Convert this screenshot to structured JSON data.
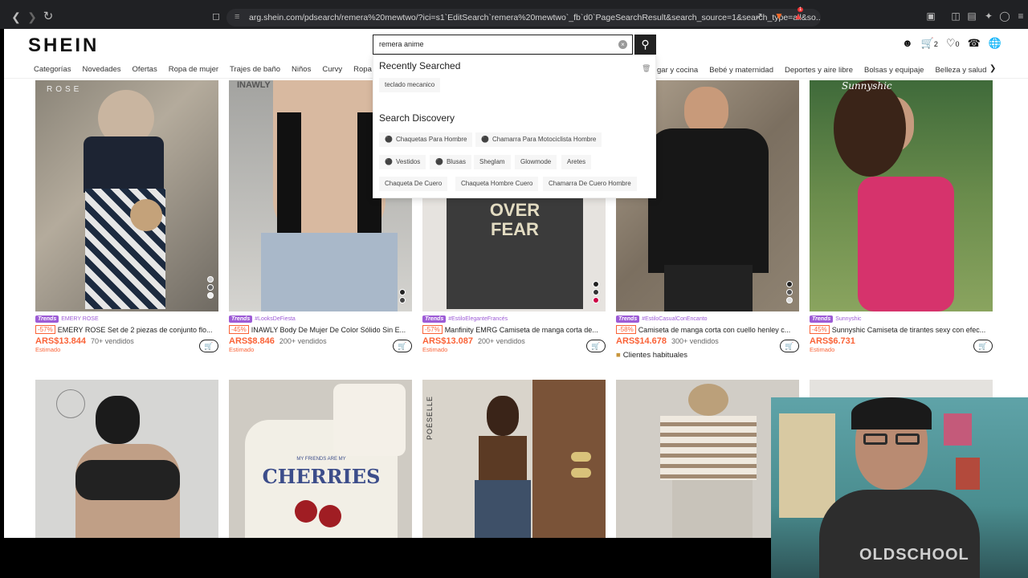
{
  "browser": {
    "url": "arg.shein.com/pdsearch/remera%20mewtwo/?ici=s1`EditSearch`remera%20mewtwo`_fb`d0`PageSearchResult&search_source=1&search_type=all&so...",
    "back_icon": "back-arrow-icon",
    "forward_icon": "forward-arrow-icon",
    "reload_icon": "reload-icon",
    "extension_badge": "1"
  },
  "header": {
    "logo": "SHEIN",
    "search_value": "remera anime",
    "cart_count": "2",
    "wishlist_count": "0"
  },
  "categories_left": [
    "Categorías",
    "Novedades",
    "Ofertas",
    "Ropa de mujer",
    "Trajes de baño",
    "Niños",
    "Curvy",
    "Ropa pa"
  ],
  "categories_right": [
    "gar y cocina",
    "Bebé y maternidad",
    "Deportes y aire libre",
    "Bolsas y equipaje",
    "Belleza y salud"
  ],
  "dropdown": {
    "recent_heading": "Recently Searched",
    "recent_items": [
      "teclado mecanico"
    ],
    "discovery_heading": "Search Discovery",
    "discovery_row1": [
      "Chaquetas Para Hombre",
      "Chamarra Para Motociclista Hombre"
    ],
    "discovery_row2": [
      "Vestidos",
      "Blusas",
      "Sheglam",
      "Glowmode",
      "Aretes"
    ],
    "discovery_row3": [
      "Chaqueta De Cuero",
      "Chaqueta Hombre Cuero",
      "Chamarra De Cuero Hombre"
    ]
  },
  "products": [
    {
      "trend_label": "Trends",
      "store": "EMERY ROSE",
      "discount": "-57%",
      "title": "EMERY ROSE Set de 2 piezas de conjunto flo...",
      "price": "ARS$13.844",
      "sold": "70+ vendidos",
      "est": "Estimado"
    },
    {
      "trend_label": "Trends",
      "store": "#LooksDeFiesta",
      "discount": "-45%",
      "title": "INAWLY Body De Mujer De Color Sólido Sin E...",
      "price": "ARS$8.846",
      "sold": "200+ vendidos",
      "est": "Estimado"
    },
    {
      "trend_label": "Trends",
      "store": "#EstiloEleganteFrancés",
      "discount": "-57%",
      "title": "Manfinity EMRG Camiseta de manga corta de...",
      "price": "ARS$13.087",
      "sold": "200+ vendidos",
      "est": "Estimado"
    },
    {
      "trend_label": "Trends",
      "store": "#EstiloCasualConEncanto",
      "discount": "-58%",
      "title": "Camiseta de manga corta con cuello henley c...",
      "price": "ARS$14.678",
      "sold": "300+ vendidos",
      "est": "",
      "extra": "Clientes habituales"
    },
    {
      "trend_label": "Trends",
      "store": "Sunnyshic",
      "discount": "-45%",
      "title": "Sunnyshic Camiseta de tirantes sexy con efec...",
      "price": "ARS$6.731",
      "sold": "",
      "est": "Estimado"
    }
  ],
  "image_text": {
    "rose": "ROSE",
    "inawly": "INAWLY",
    "tshirt": "OVER FEAR",
    "sunnyshic": "Sunnyshic",
    "cherries_top": "MY FRIENDS ARE MY",
    "cherries": "CHERRIES",
    "poesie": "POÉSELLE",
    "oldschool": "OLDSCHOOL"
  },
  "colors": {
    "accent": "#fa6338",
    "trend": "#9d5bd6",
    "dark": "#222222"
  }
}
